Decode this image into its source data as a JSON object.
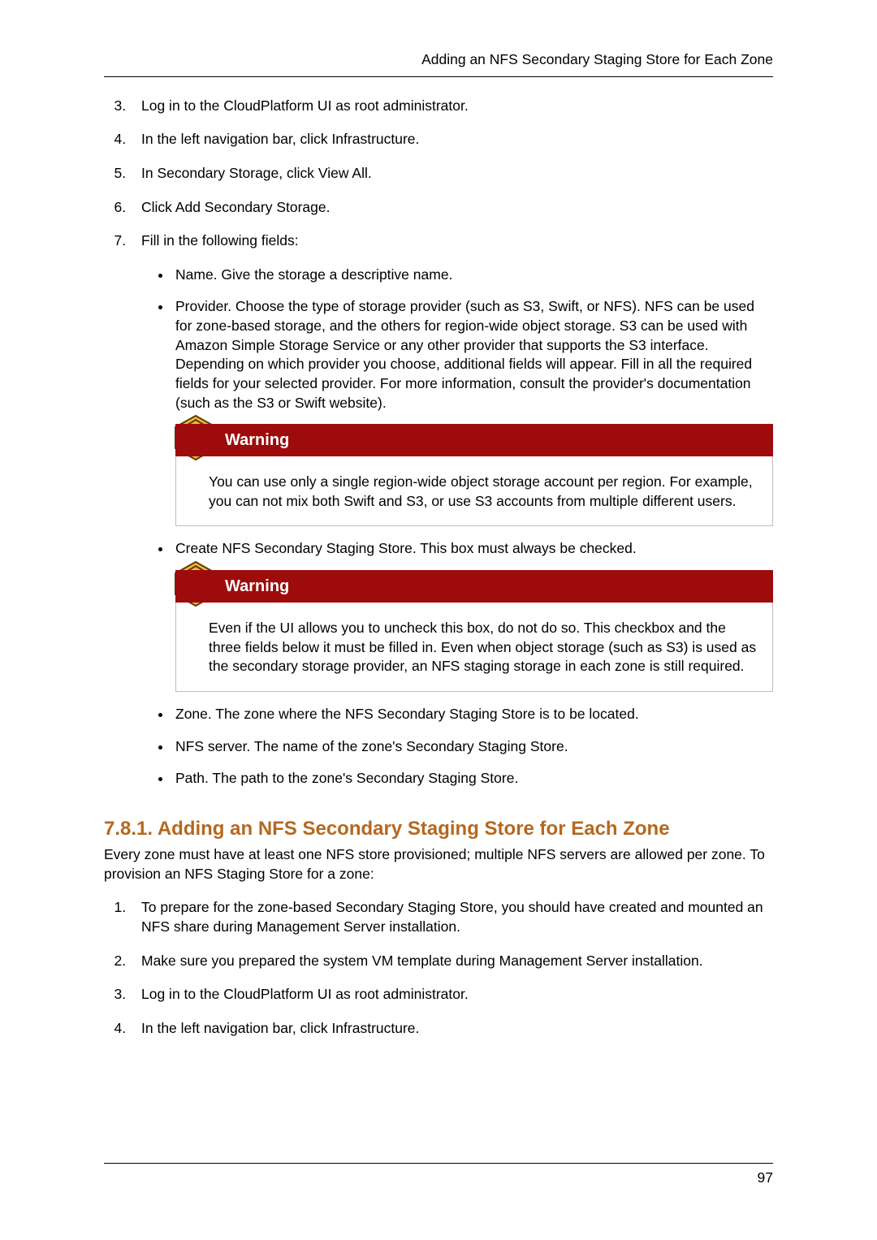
{
  "header": {
    "running_title": "Adding an NFS Secondary Staging Store for Each Zone"
  },
  "list1": {
    "start": 3,
    "items": [
      "Log in to the CloudPlatform UI as root administrator.",
      "In the left navigation bar, click Infrastructure.",
      "In Secondary Storage, click View All.",
      "Click Add Secondary Storage.",
      "Fill in the following fields:"
    ]
  },
  "fields": {
    "name": "Name. Give the storage a descriptive name.",
    "provider": "Provider. Choose the type of storage provider (such as S3, Swift, or NFS). NFS can be used for zone-based storage, and the others for region-wide object storage. S3 can be used with Amazon Simple Storage Service or any other provider that supports the S3 interface. Depending on which provider you choose, additional fields will appear. Fill in all the required fields for your selected provider. For more information, consult the provider's documentation (such as the S3 or Swift website).",
    "create_nfs": "Create NFS Secondary Staging Store. This box must always be checked.",
    "zone": "Zone. The zone where the NFS Secondary Staging Store is to be located.",
    "nfs_server": "NFS server. The name of the zone's Secondary Staging Store.",
    "path": "Path. The path to the zone's Secondary Staging Store."
  },
  "warnings": {
    "label": "Warning",
    "one": "You can use only a single region-wide object storage account per region. For example, you can not mix both Swift and S3, or use S3 accounts from multiple different users.",
    "two": "Even if the UI allows you to uncheck this box, do not do so. This checkbox and the three fields below it must be filled in. Even when object storage (such as S3) is used as the secondary storage provider, an NFS staging storage in each zone is still required."
  },
  "section": {
    "number": "7.8.1.",
    "title": "Adding an NFS Secondary Staging Store for Each Zone",
    "intro": "Every zone must have at least one NFS store provisioned; multiple NFS servers are allowed per zone. To provision an NFS Staging Store for a zone:"
  },
  "list2": {
    "start": 1,
    "items": [
      "To prepare for the zone-based Secondary Staging Store, you should have created and mounted an NFS share during Management Server installation.",
      "Make sure you prepared the system VM template during Management Server installation.",
      "Log in to the CloudPlatform UI as root administrator.",
      "In the left navigation bar, click Infrastructure."
    ]
  },
  "footer": {
    "page": "97"
  }
}
